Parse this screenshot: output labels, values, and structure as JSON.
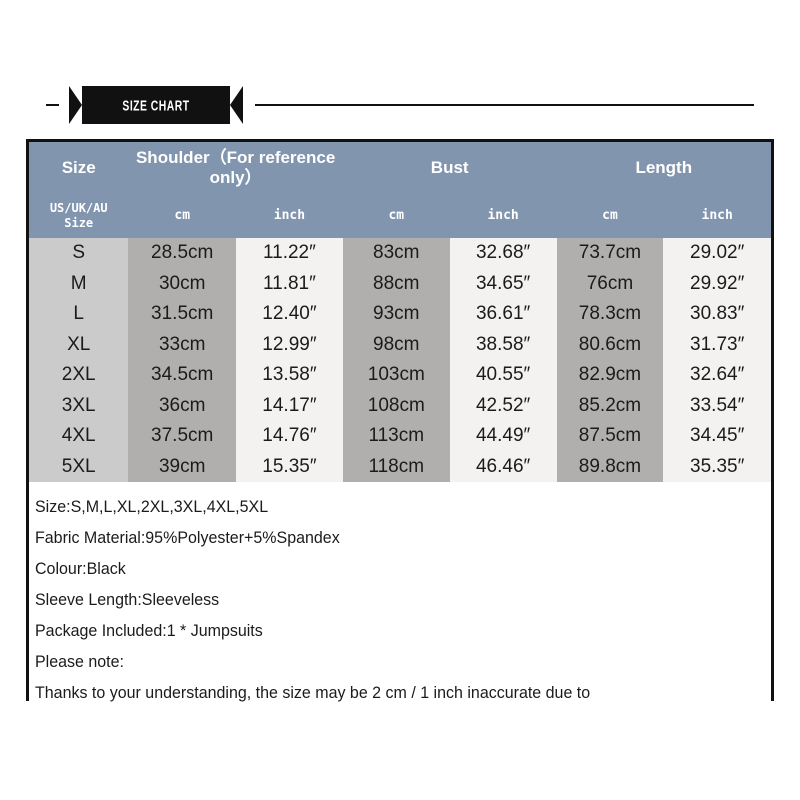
{
  "banner": {
    "title": "SIZE CHART"
  },
  "table": {
    "header_groups": [
      {
        "label": "Size",
        "rowspan": 2
      },
      {
        "label": "Shoulder（For reference only）",
        "colspan": 2
      },
      {
        "label": "Bust",
        "colspan": 2
      },
      {
        "label": "Length",
        "colspan": 2
      }
    ],
    "sub_headers": [
      "US/UK/AU\nSize",
      "cm",
      "inch",
      "cm",
      "inch",
      "cm",
      "inch"
    ],
    "sub_header_size_line1": "US/UK/AU",
    "sub_header_size_line2": "Size",
    "sub_header_cm": "cm",
    "sub_header_inch": "inch",
    "columns": [
      "Size",
      "Shoulder cm",
      "Shoulder inch",
      "Bust cm",
      "Bust inch",
      "Length cm",
      "Length inch"
    ],
    "rows": [
      {
        "size": "S",
        "shoulder_cm": "28.5cm",
        "shoulder_in": "11.22″",
        "bust_cm": "83cm",
        "bust_in": "32.68″",
        "length_cm": "73.7cm",
        "length_in": "29.02″"
      },
      {
        "size": "M",
        "shoulder_cm": "30cm",
        "shoulder_in": "11.81″",
        "bust_cm": "88cm",
        "bust_in": "34.65″",
        "length_cm": "76cm",
        "length_in": "29.92″"
      },
      {
        "size": "L",
        "shoulder_cm": "31.5cm",
        "shoulder_in": "12.40″",
        "bust_cm": "93cm",
        "bust_in": "36.61″",
        "length_cm": "78.3cm",
        "length_in": "30.83″"
      },
      {
        "size": "XL",
        "shoulder_cm": "33cm",
        "shoulder_in": "12.99″",
        "bust_cm": "98cm",
        "bust_in": "38.58″",
        "length_cm": "80.6cm",
        "length_in": "31.73″"
      },
      {
        "size": "2XL",
        "shoulder_cm": "34.5cm",
        "shoulder_in": "13.58″",
        "bust_cm": "103cm",
        "bust_in": "40.55″",
        "length_cm": "82.9cm",
        "length_in": "32.64″"
      },
      {
        "size": "3XL",
        "shoulder_cm": "36cm",
        "shoulder_in": "14.17″",
        "bust_cm": "108cm",
        "bust_in": "42.52″",
        "length_cm": "85.2cm",
        "length_in": "33.54″"
      },
      {
        "size": "4XL",
        "shoulder_cm": "37.5cm",
        "shoulder_in": "14.76″",
        "bust_cm": "113cm",
        "bust_in": "44.49″",
        "length_cm": "87.5cm",
        "length_in": "34.45″"
      },
      {
        "size": "5XL",
        "shoulder_cm": "39cm",
        "shoulder_in": "15.35″",
        "bust_cm": "118cm",
        "bust_in": "46.46″",
        "length_cm": "89.8cm",
        "length_in": "35.35″"
      }
    ]
  },
  "notes": [
    "Size:S,M,L,XL,2XL,3XL,4XL,5XL",
    "Fabric Material:95%Polyester+5%Spandex",
    "Colour:Black",
    "Sleeve Length:Sleeveless",
    "Package Included:1 * Jumpsuits",
    "Please note:",
    "Thanks to your understanding, the size may be 2 cm / 1 inch inaccurate due to"
  ],
  "colors": {
    "header_blue": "#8195af",
    "cm_gray": "#b1afad",
    "inch_gray": "#f3f2f0",
    "size_gray": "#cbcbcb",
    "frame_black": "#111111",
    "text_dark": "#1b1b1b"
  }
}
